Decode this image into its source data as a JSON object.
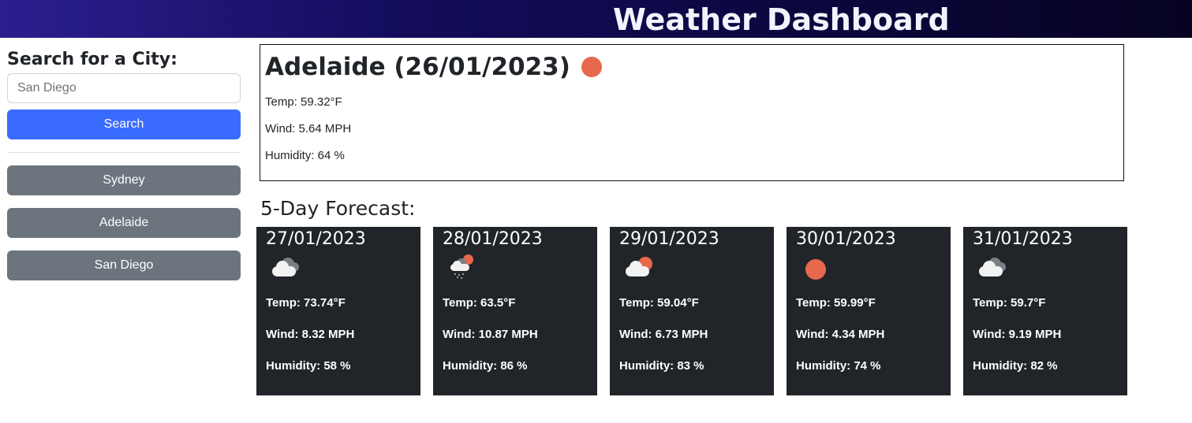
{
  "header": {
    "title": "Weather Dashboard"
  },
  "search": {
    "heading": "Search for a City:",
    "placeholder": "San Diego",
    "button_label": "Search"
  },
  "history": [
    "Sydney",
    "Adelaide",
    "San Diego"
  ],
  "current": {
    "title": "Adelaide (26/01/2023)",
    "icon": "sun-icon",
    "temp": "Temp: 59.32°F",
    "wind": "Wind: 5.64 MPH",
    "humidity": "Humidity: 64 %"
  },
  "forecast_heading": "5-Day Forecast:",
  "forecast": [
    {
      "date": "27/01/2023",
      "icon": "cloudy-icon",
      "temp": "Temp: 73.74°F",
      "wind": "Wind: 8.32 MPH",
      "humidity": "Humidity: 58 %"
    },
    {
      "date": "28/01/2023",
      "icon": "sun-rain-icon",
      "temp": "Temp: 63.5°F",
      "wind": "Wind: 10.87 MPH",
      "humidity": "Humidity: 86 %"
    },
    {
      "date": "29/01/2023",
      "icon": "partly-cloudy-icon",
      "temp": "Temp: 59.04°F",
      "wind": "Wind: 6.73 MPH",
      "humidity": "Humidity: 83 %"
    },
    {
      "date": "30/01/2023",
      "icon": "sun-icon",
      "temp": "Temp: 59.99°F",
      "wind": "Wind: 4.34 MPH",
      "humidity": "Humidity: 74 %"
    },
    {
      "date": "31/01/2023",
      "icon": "cloudy-icon",
      "temp": "Temp: 59.7°F",
      "wind": "Wind: 9.19 MPH",
      "humidity": "Humidity: 82 %"
    }
  ],
  "colors": {
    "accent": "#3a6bff",
    "history_button": "#6c757d",
    "card_bg": "#212529",
    "sun": "#e7694d"
  }
}
